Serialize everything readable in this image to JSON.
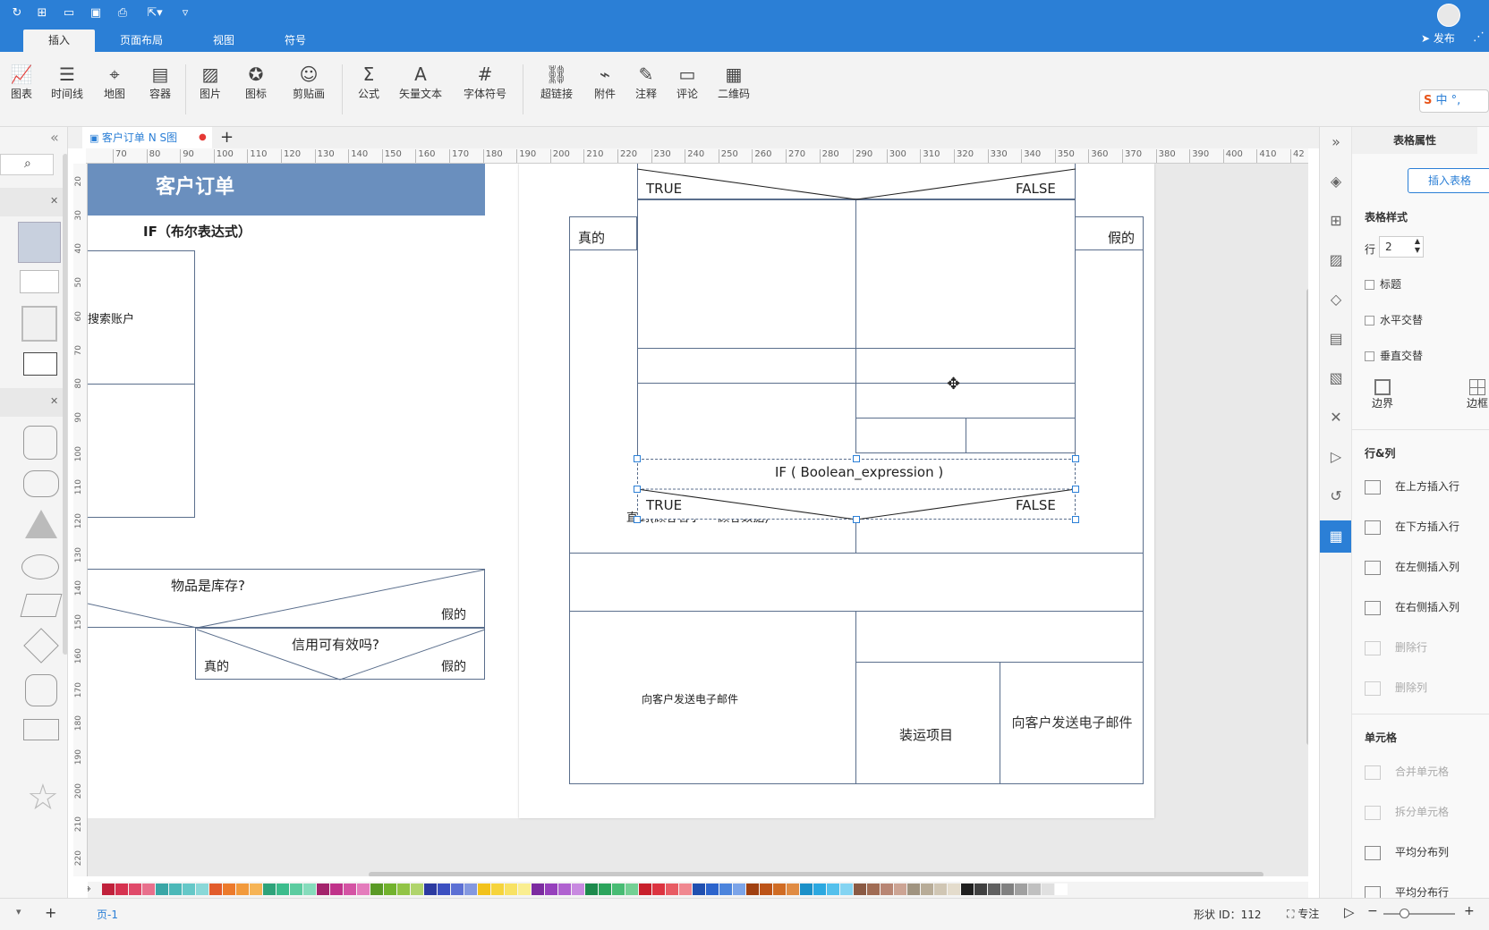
{
  "ribbon": {
    "tabs": [
      "插入",
      "页面布局",
      "视图",
      "符号"
    ],
    "publish_label": "发布",
    "insert_label": "插入表格"
  },
  "toolbar": {
    "items": [
      "图表",
      "时间线",
      "地图",
      "容器",
      "图片",
      "图标",
      "剪贴画",
      "公式",
      "矢量文本",
      "字体符号",
      "超链接",
      "附件",
      "注释",
      "评论",
      "二维码"
    ]
  },
  "document_tab": {
    "title": "客户订单 N S图"
  },
  "ruler": {
    "h_ticks": [
      "70",
      "80",
      "90",
      "100",
      "110",
      "120",
      "130",
      "140",
      "150",
      "160",
      "170",
      "180",
      "190",
      "200",
      "210",
      "220",
      "230",
      "240",
      "250",
      "260",
      "270",
      "280",
      "290",
      "300",
      "310",
      "320",
      "330",
      "340",
      "350",
      "360",
      "370",
      "380",
      "390",
      "400",
      "410",
      "42"
    ],
    "v_ticks": [
      "20",
      "30",
      "40",
      "50",
      "60",
      "70",
      "80",
      "90",
      "100",
      "110",
      "120",
      "130",
      "140",
      "150",
      "160",
      "170",
      "180",
      "190",
      "200",
      "210",
      "220"
    ]
  },
  "left_diagram": {
    "title": "客户订单",
    "if_label": "IF（布尔表达式）",
    "search_label": "搜索账户",
    "stock_question": "物品是库存?",
    "stock_false": "假的",
    "credit_question": "信用可有效吗?",
    "credit_true": "真的",
    "credit_false": "假的"
  },
  "right_diagram": {
    "top_true": "TRUE",
    "top_false": "FALSE",
    "outer_true": "真的",
    "outer_false": "假的",
    "if_expression": "IF ( Boolean_expression )",
    "sel_true": "TRUE",
    "sel_false": "FALSE",
    "hidden_text": "直到(顾客名字 = 顾客数据)",
    "send_email_left": "向客户发送电子邮件",
    "ship_items": "装运项目",
    "send_email_right": "向客户发送电子邮件"
  },
  "right_panel": {
    "tab_label": "表格属性",
    "insert_table_label": "插入表格",
    "table_style_label": "表格样式",
    "rows_label": "行",
    "rows_value": "2",
    "title_check": "标题",
    "horiz_alt": "水平交替",
    "vert_alt": "垂直交替",
    "border_label": "边界",
    "frame_label": "边框",
    "rowcol_label": "行&列",
    "insert_above": "在上方插入行",
    "insert_below": "在下方插入行",
    "insert_left": "在左侧插入列",
    "insert_right": "在右侧插入列",
    "delete_row": "删除行",
    "delete_col": "删除列",
    "cell_label": "单元格",
    "merge_cells": "合并单元格",
    "split_cells": "拆分单元格",
    "dist_cols": "平均分布列",
    "dist_rows": "平均分布行"
  },
  "statusbar": {
    "page_label": "页-1",
    "shape_id": "形状 ID：112",
    "focus_label": "专注"
  },
  "palette": [
    "#c0213b",
    "#d63250",
    "#e04a6a",
    "#e8708c",
    "#3aa6a6",
    "#4cb8b8",
    "#66c8c8",
    "#8ad8d8",
    "#e25c2c",
    "#ec7a2c",
    "#f29a3c",
    "#f6b456",
    "#2ea37a",
    "#3cbc8c",
    "#5ccca0",
    "#86dcbc",
    "#a3246c",
    "#c0338a",
    "#d454a4",
    "#e47cbc",
    "#5a9a26",
    "#72b22e",
    "#92c446",
    "#b0d46c",
    "#2c3aa0",
    "#3c50c0",
    "#5c70d4",
    "#8498e0",
    "#f2c21c",
    "#f6d43c",
    "#f8e264",
    "#faee90",
    "#7c2ca0",
    "#9640bc",
    "#b062d0",
    "#c88ae0",
    "#1c8a4c",
    "#2ca45c",
    "#48bc74",
    "#74d094",
    "#c8202c",
    "#dc3440",
    "#e85c64",
    "#f08890",
    "#2050b0",
    "#2c64cc",
    "#4c84dc",
    "#7ca4e8",
    "#a04010",
    "#bc5418",
    "#d06c24",
    "#e08c44",
    "#1c90c8",
    "#2ca8e0",
    "#54c0ec",
    "#84d4f2",
    "#8a5a44",
    "#a06c54",
    "#b88674",
    "#cca494",
    "#a09480",
    "#b8ac98",
    "#d0c6b4",
    "#e4dccc",
    "#202020",
    "#404040",
    "#606060",
    "#808080",
    "#a0a0a0",
    "#c0c0c0",
    "#e0e0e0",
    "#ffffff"
  ]
}
